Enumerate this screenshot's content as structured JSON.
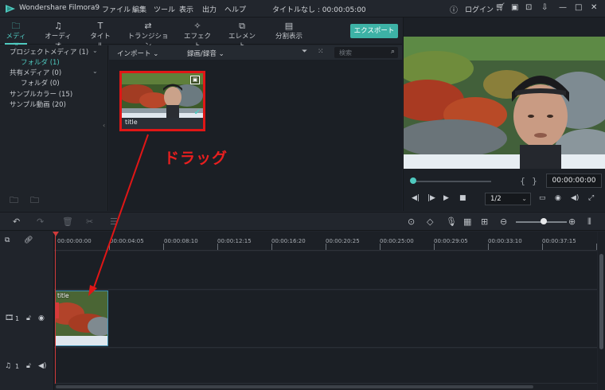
{
  "titlebar": {
    "app_name": "Wondershare Filmora9",
    "menus": [
      "ファイル",
      "編集",
      "ツール",
      "表示",
      "出力",
      "ヘルプ"
    ],
    "doc_title": "タイトルなし : 00:00:05:00",
    "login_label": "ログイン"
  },
  "tabs": [
    {
      "label": "メディア",
      "icon": "folder-icon",
      "active": true
    },
    {
      "label": "オーディオ",
      "icon": "music-note-icon"
    },
    {
      "label": "タイトル",
      "icon": "text-icon"
    },
    {
      "label": "トランジション",
      "icon": "transition-icon"
    },
    {
      "label": "エフェクト",
      "icon": "effects-icon"
    },
    {
      "label": "エレメント",
      "icon": "element-icon"
    },
    {
      "label": "分割表示",
      "icon": "split-screen-icon"
    }
  ],
  "export_label": "エクスポート",
  "tree": {
    "items": [
      {
        "label": "プロジェクトメディア (1)"
      },
      {
        "label": "フォルダ (1)",
        "selected": true
      },
      {
        "label": "共有メディア (0)"
      },
      {
        "label": "フォルダ (0)"
      },
      {
        "label": "サンプルカラー (15)"
      },
      {
        "label": "サンプル動画 (20)"
      }
    ]
  },
  "media_bar": {
    "import_label": "インポート",
    "record_label": "録画/録音",
    "search_placeholder": "検索"
  },
  "media_clip": {
    "title": "title"
  },
  "annotation": {
    "drag_label": "ドラッグ",
    "color": "#e81f1f"
  },
  "preview": {
    "timecode": "00:00:00:00",
    "ratio": "1/2"
  },
  "ruler": {
    "ticks": [
      "00:00:00:00",
      "00:00:04:05",
      "00:00:08:10",
      "00:00:12:15",
      "00:00:16:20",
      "00:00:20:25",
      "00:00:25:00",
      "00:00:29:05",
      "00:00:33:10",
      "00:00:37:15"
    ]
  },
  "timeline": {
    "video_track_num": "1",
    "audio_track_num": "1",
    "clip_title": "title"
  },
  "colors": {
    "accent": "#4fc9bf",
    "highlight": "#e01616",
    "playhead": "#d03a3a"
  }
}
